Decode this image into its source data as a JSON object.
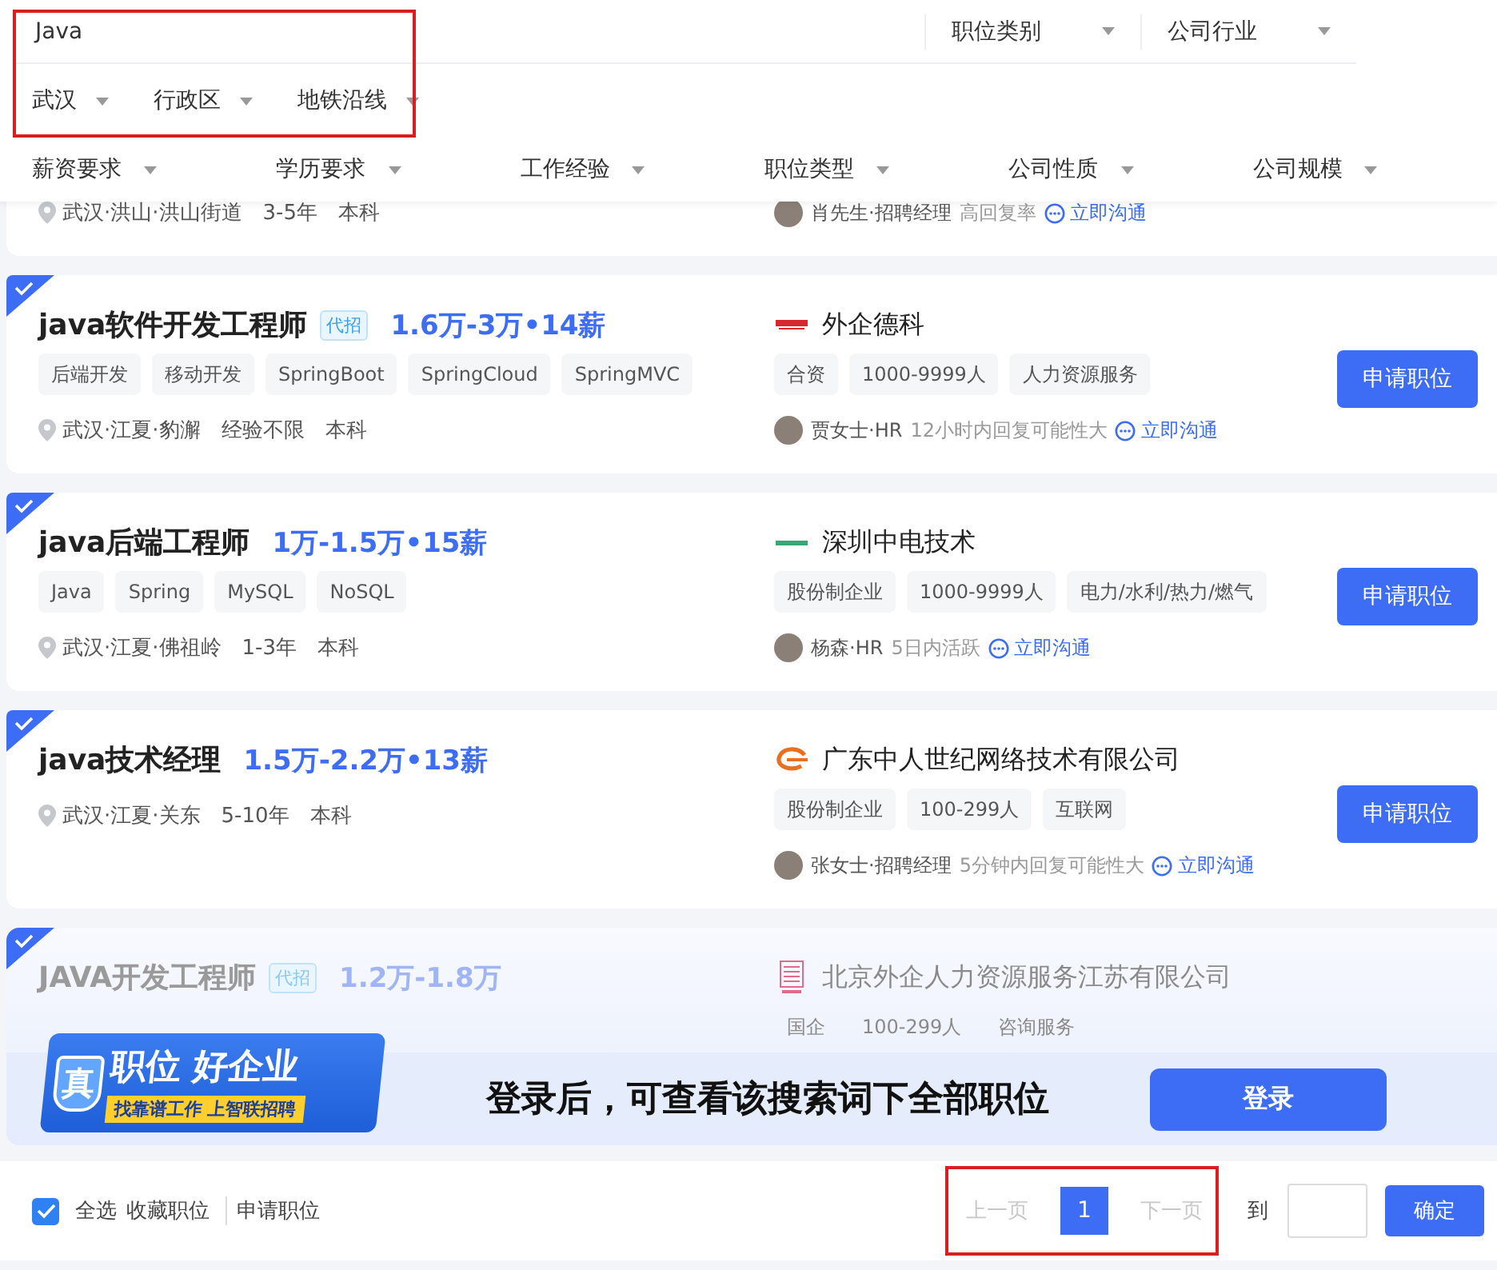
{
  "search": {
    "value": "Java",
    "highlighted": true
  },
  "header_filters": [
    {
      "label": "职位类别"
    },
    {
      "label": "公司行业"
    }
  ],
  "location_filters": [
    {
      "label": "武汉"
    },
    {
      "label": "行政区"
    },
    {
      "label": "地铁沿线"
    }
  ],
  "filters": [
    {
      "label": "薪资要求"
    },
    {
      "label": "学历要求"
    },
    {
      "label": "工作经验"
    },
    {
      "label": "职位类型"
    },
    {
      "label": "公司性质"
    },
    {
      "label": "公司规模"
    }
  ],
  "jobs": [
    {
      "kind": "partial",
      "location": "武汉·洪山·洪山街道",
      "experience": "3-5年",
      "education": "本科",
      "recruiter": "肖先生·招聘经理",
      "activity": "高回复率",
      "chat": "立即沟通"
    },
    {
      "kind": "full",
      "selected": true,
      "faded": false,
      "title": "java软件开发工程师",
      "badge": "代招",
      "salary": "1.6万-3万•14薪",
      "tags": [
        "后端开发",
        "移动开发",
        "SpringBoot",
        "SpringCloud",
        "SpringMVC"
      ],
      "location": "武汉·江夏·豹澥",
      "experience": "经验不限",
      "education": "本科",
      "logo": {
        "kind": "bar"
      },
      "company": "外企德科",
      "company_tags": [
        "合资",
        "1000-9999人",
        "人力资源服务"
      ],
      "recruiter": "贾女士·HR",
      "activity": "12小时内回复可能性大",
      "chat": "立即沟通",
      "apply": "申请职位"
    },
    {
      "kind": "full",
      "selected": true,
      "faded": false,
      "title": "java后端工程师",
      "salary": "1万-1.5万•15薪",
      "tags": [
        "Java",
        "Spring",
        "MySQL",
        "NoSQL"
      ],
      "location": "武汉·江夏·佛祖岭",
      "experience": "1-3年",
      "education": "本科",
      "logo": {
        "kind": "stripe"
      },
      "company": "深圳中电技术",
      "company_tags": [
        "股份制企业",
        "1000-9999人",
        "电力/水利/热力/燃气"
      ],
      "recruiter": "杨森·HR",
      "activity": "5日内活跃",
      "chat": "立即沟通",
      "apply": "申请职位"
    },
    {
      "kind": "full",
      "selected": true,
      "faded": false,
      "title": "java技术经理",
      "salary": "1.5万-2.2万•13薪",
      "location": "武汉·江夏·关东",
      "experience": "5-10年",
      "education": "本科",
      "logo": {
        "kind": "swoosh"
      },
      "company": "广东中人世纪网络技术有限公司",
      "company_tags": [
        "股份制企业",
        "100-299人",
        "互联网"
      ],
      "recruiter": "张女士·招聘经理",
      "activity": "5分钟内回复可能性大",
      "chat": "立即沟通",
      "apply": "申请职位"
    },
    {
      "kind": "full",
      "selected": true,
      "faded": true,
      "title": "JAVA开发工程师",
      "badge": "代招",
      "salary": "1.2万-1.8万",
      "logo": {
        "kind": "grid"
      },
      "company": "北京外企人力资源服务江苏有限公司",
      "company_tags": [
        "国企",
        "100-299人",
        "咨询服务"
      ]
    }
  ],
  "login_prompt": {
    "banner": {
      "badge": "真",
      "title": "职位 好企业",
      "slogan": "找靠谱工作 上智联招聘"
    },
    "message": "登录后，可查看该搜索词下全部职位",
    "button": "登录"
  },
  "footer": {
    "select_all": {
      "label": "全选",
      "checked": true
    },
    "actions": [
      "收藏职位",
      "申请职位"
    ],
    "pagination": {
      "highlighted": true,
      "prev": {
        "label": "上一页",
        "disabled": true
      },
      "pages": [
        {
          "label": "1",
          "selected": true
        }
      ],
      "next": {
        "label": "下一页",
        "disabled": true
      }
    },
    "goto_label": "到",
    "confirm": "确定"
  }
}
